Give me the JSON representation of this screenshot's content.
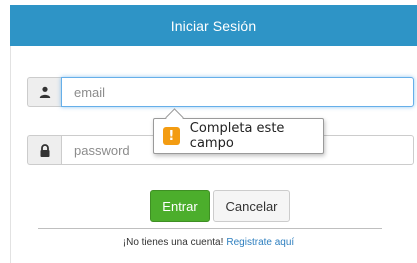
{
  "header": {
    "title": "Iniciar Sesión"
  },
  "form": {
    "email": {
      "placeholder": "email",
      "value": "",
      "icon": "user-icon"
    },
    "password": {
      "placeholder": "password",
      "value": "",
      "icon": "lock-icon"
    }
  },
  "tooltip": {
    "text": "Completa este campo",
    "icon": "warning-icon",
    "icon_glyph": "!"
  },
  "buttons": {
    "enter": "Entrar",
    "cancel": "Cancelar"
  },
  "footer": {
    "prompt": "¡No tienes una cuenta!",
    "link": "Registrate aquí"
  },
  "colors": {
    "header": "#2e94c6",
    "enter_button": "#4cae2c",
    "warning": "#f39c12",
    "link": "#2e7fbf"
  }
}
